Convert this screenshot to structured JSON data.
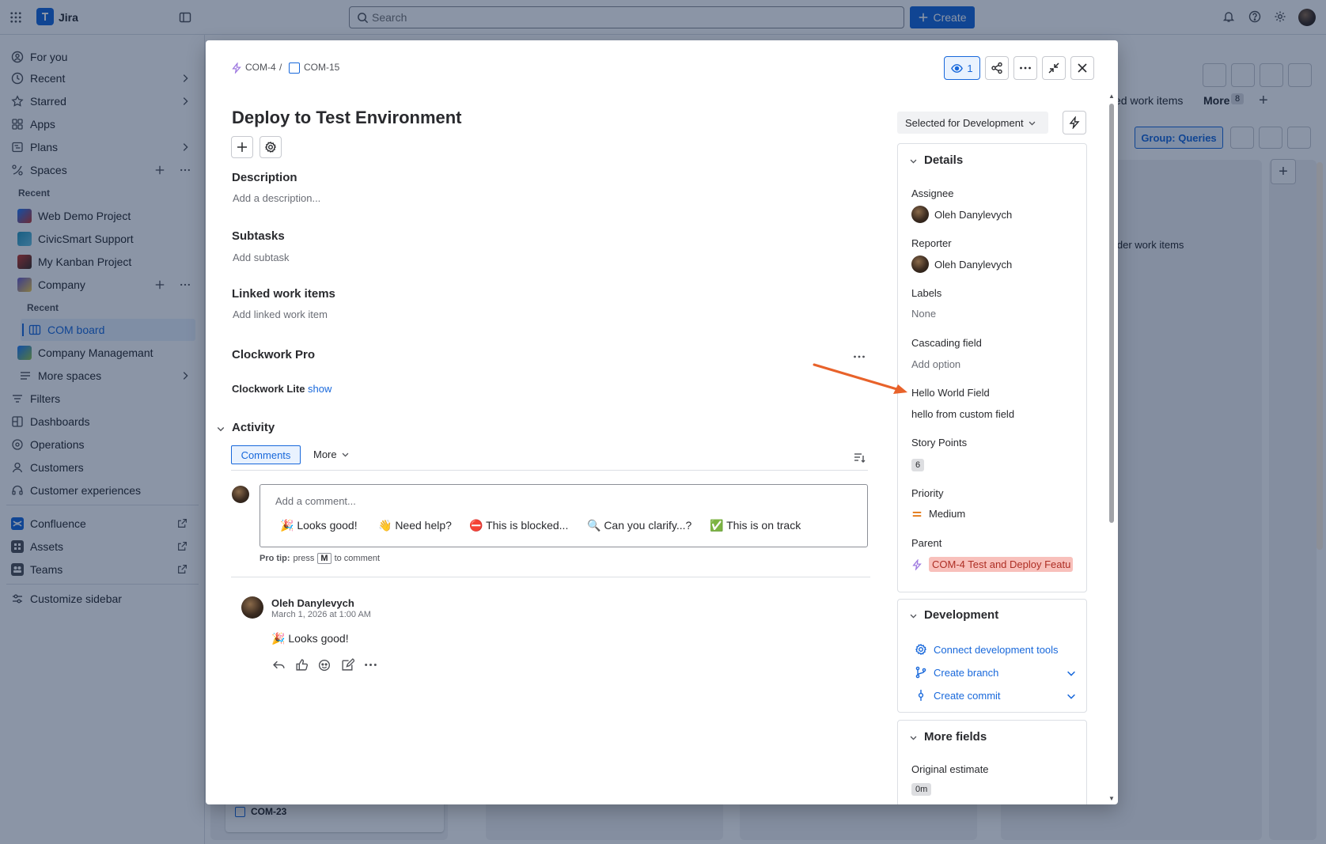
{
  "topbar": {
    "app_name": "Jira",
    "search_placeholder": "Search",
    "create_label": "Create"
  },
  "sidebar": {
    "items": [
      {
        "label": "For you"
      },
      {
        "label": "Recent"
      },
      {
        "label": "Starred"
      },
      {
        "label": "Apps"
      },
      {
        "label": "Plans"
      },
      {
        "label": "Spaces"
      }
    ],
    "recent_heading": "Recent",
    "projects": [
      {
        "label": "Web Demo Project",
        "color": "#1d7afc"
      },
      {
        "label": "CivicSmart Support",
        "color": "#2898bd"
      },
      {
        "label": "My Kanban Project",
        "color": "#c9372c"
      },
      {
        "label": "Company",
        "color": "#6a5acd"
      }
    ],
    "company_recent_heading": "Recent",
    "com_board": "COM board",
    "company_management": "Company Managemant",
    "more_spaces": "More spaces",
    "bottom_items": [
      {
        "label": "Filters"
      },
      {
        "label": "Dashboards"
      },
      {
        "label": "Operations"
      },
      {
        "label": "Customers"
      },
      {
        "label": "Customer experiences"
      }
    ],
    "apps": [
      {
        "label": "Confluence"
      },
      {
        "label": "Assets"
      },
      {
        "label": "Teams"
      }
    ],
    "customize": "Customize sidebar"
  },
  "board": {
    "tab_partial": "ed work items",
    "more_tab": "More",
    "more_count": "8",
    "group_button": "Group: Queries",
    "older_text": "lder work items",
    "card_key": "COM-23"
  },
  "modal": {
    "breadcrumb": {
      "parent_key": "COM-4",
      "separator": "/",
      "issue_key": "COM-15"
    },
    "watch_count": "1",
    "title": "Deploy to Test Environment",
    "description": {
      "heading": "Description",
      "placeholder": "Add a description..."
    },
    "subtasks": {
      "heading": "Subtasks",
      "placeholder": "Add subtask"
    },
    "linked": {
      "heading": "Linked work items",
      "placeholder": "Add linked work item"
    },
    "clockwork": {
      "heading": "Clockwork Pro",
      "lite_label": "Clockwork Lite",
      "show_link": "show"
    },
    "activity": {
      "heading": "Activity",
      "tab_comments": "Comments",
      "tab_more": "More",
      "comment_placeholder": "Add a comment...",
      "quick_replies": [
        "🎉 Looks good!",
        "👋 Need help?",
        "⛔ This is blocked...",
        "🔍 Can you clarify...?",
        "✅ This is on track"
      ],
      "pro_tip_label": "Pro tip:",
      "pro_tip_press": "press",
      "pro_tip_key": "M",
      "pro_tip_suffix": "to comment",
      "comment": {
        "author": "Oleh Danylevych",
        "timestamp": "March 1, 2026 at 1:00 AM",
        "body": "🎉 Looks good!"
      }
    },
    "status": "Selected for Development",
    "details": {
      "heading": "Details",
      "assignee_label": "Assignee",
      "assignee": "Oleh Danylevych",
      "reporter_label": "Reporter",
      "reporter": "Oleh Danylevych",
      "labels_label": "Labels",
      "labels_value": "None",
      "cascading_label": "Cascading field",
      "cascading_value": "Add option",
      "hello_label": "Hello World Field",
      "hello_value": "hello from custom field",
      "story_points_label": "Story Points",
      "story_points": "6",
      "priority_label": "Priority",
      "priority": "Medium",
      "parent_label": "Parent",
      "parent": "COM-4 Test and Deploy Featu"
    },
    "development": {
      "heading": "Development",
      "connect": "Connect development tools",
      "branch": "Create branch",
      "commit": "Create commit"
    },
    "more_fields": {
      "heading": "More fields",
      "estimate_label": "Original estimate",
      "estimate_value": "0m"
    }
  },
  "colors": {
    "accent": "#1868db",
    "annotation_arrow": "#e8622a",
    "priority_medium": "#e06c00",
    "parent_highlight": "#f8c0bb"
  }
}
